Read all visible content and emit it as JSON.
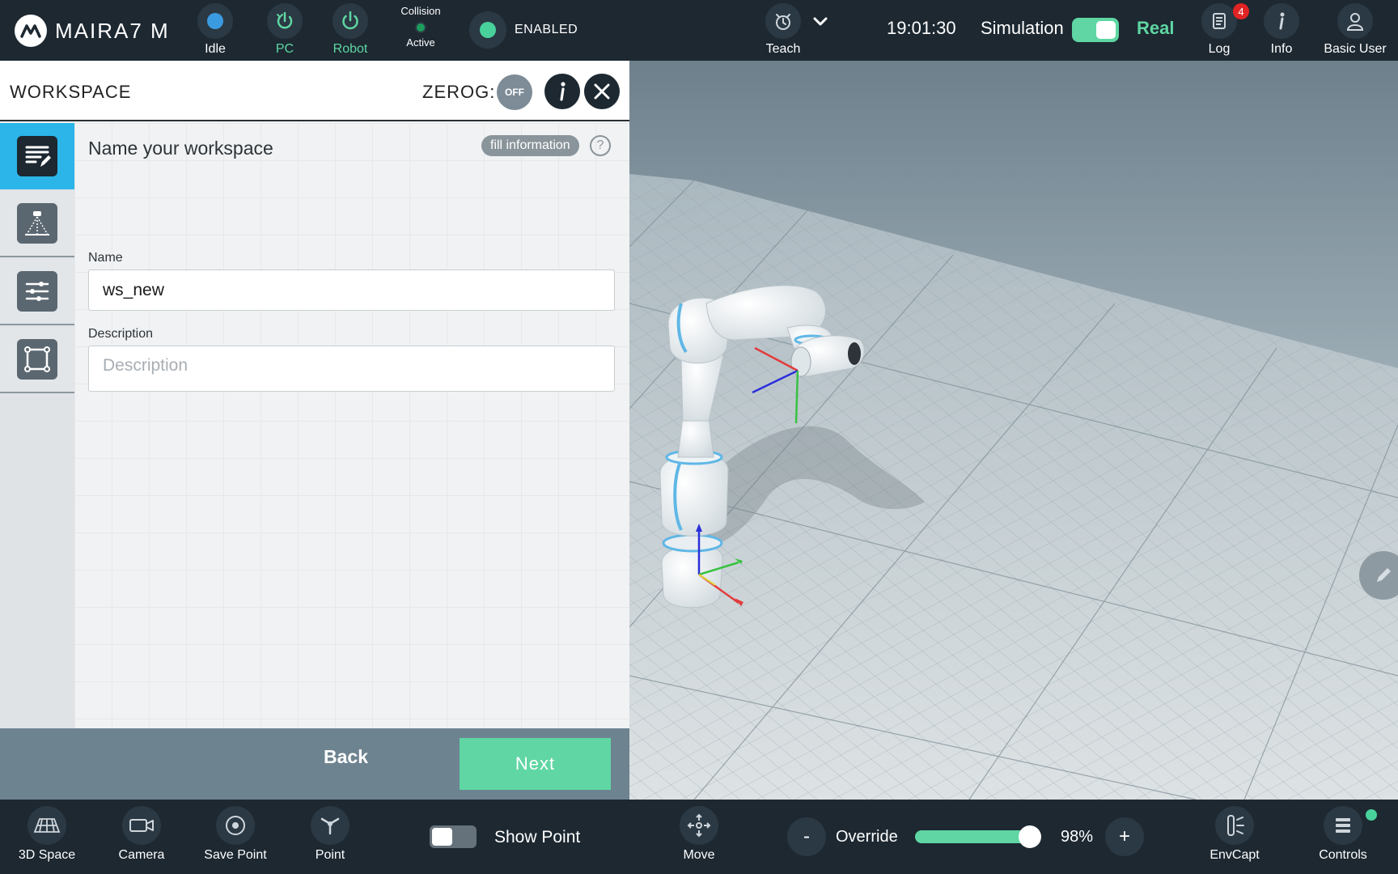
{
  "app": {
    "brand": "MAIRA7 M"
  },
  "topbar": {
    "status_idle": "Idle",
    "pc": "PC",
    "robot": "Robot",
    "collision_title": "Collision",
    "collision_state": "Active",
    "enabled": "ENABLED",
    "teach": "Teach",
    "time": "19:01:30",
    "simulation": "Simulation",
    "real": "Real",
    "log": "Log",
    "log_badge": "4",
    "info": "Info",
    "user": "Basic User"
  },
  "panel": {
    "title": "WORKSPACE",
    "zerog_label": "ZEROG:",
    "zerog_state": "OFF",
    "step_title": "Name your workspace",
    "fill_info": "fill information",
    "help": "?",
    "name_label": "Name",
    "name_value": "ws_new",
    "desc_label": "Description",
    "desc_placeholder": "Description",
    "back": "Back",
    "next": "Next"
  },
  "bottombar": {
    "space3d": "3D Space",
    "camera": "Camera",
    "save_point": "Save Point",
    "point": "Point",
    "show_point": "Show Point",
    "move": "Move",
    "minus": "-",
    "override": "Override",
    "override_value": 0.98,
    "override_pct": "98%",
    "plus": "+",
    "envcapt": "EnvCapt",
    "controls": "Controls"
  },
  "colors": {
    "accent": "#5fd6a3",
    "tab_active": "#2bb5e8",
    "bar_bg": "#1d2831",
    "badge": "#e02424"
  }
}
